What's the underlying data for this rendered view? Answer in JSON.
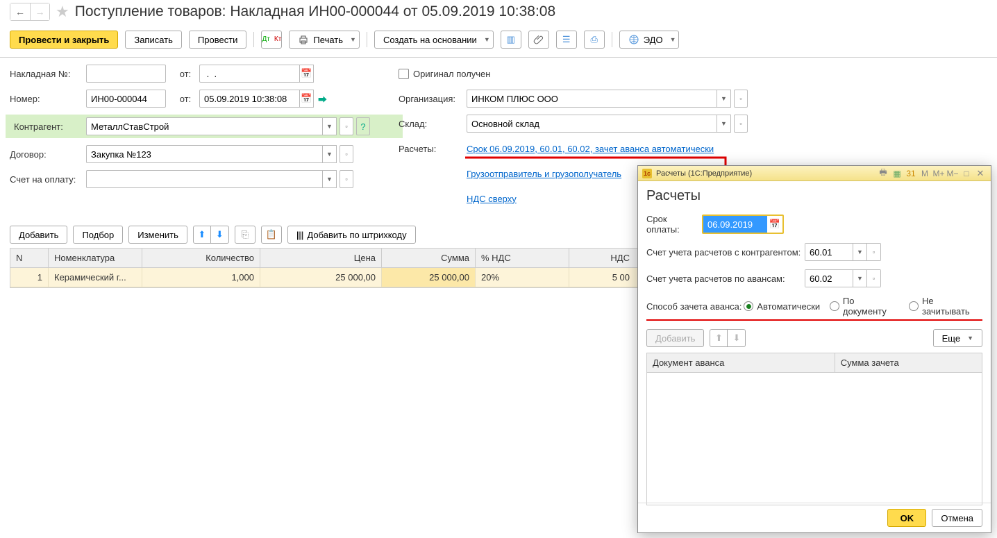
{
  "header": {
    "title": "Поступление товаров: Накладная ИН00-000044 от 05.09.2019 10:38:08"
  },
  "toolbar": {
    "post_close": "Провести и закрыть",
    "save": "Записать",
    "post": "Провести",
    "print": "Печать",
    "create_based": "Создать на основании",
    "edo": "ЭДО"
  },
  "form": {
    "invoice_no_lbl": "Накладная №:",
    "invoice_no": "",
    "from_lbl": "от:",
    "invoice_date": " .  .",
    "number_lbl": "Номер:",
    "number": "ИН00-000044",
    "date": "05.09.2019 10:38:08",
    "counterparty_lbl": "Контрагент:",
    "counterparty": "МеталлСтавСтрой",
    "contract_lbl": "Договор:",
    "contract": "Закупка №123",
    "bill_lbl": "Счет на оплату:",
    "bill": "",
    "original_lbl": "Оригинал получен",
    "org_lbl": "Организация:",
    "org": "ИНКОМ ПЛЮС ООО",
    "warehouse_lbl": "Склад:",
    "warehouse": "Основной склад",
    "calc_lbl": "Расчеты:",
    "calc_link": "Срок 06.09.2019, 60.01, 60.02, зачет аванса автоматически",
    "shipper_link": "Грузоотправитель и грузополучатель",
    "vat_link": "НДС сверху"
  },
  "tbl_toolbar": {
    "add": "Добавить",
    "pick": "Подбор",
    "edit": "Изменить",
    "barcode": "Добавить по штрихкоду"
  },
  "table": {
    "headers": {
      "n": "N",
      "nom": "Номенклатура",
      "qty": "Количество",
      "price": "Цена",
      "sum": "Сумма",
      "vat": "% НДС",
      "vat_sum": "НДС"
    },
    "rows": [
      {
        "n": "1",
        "nom": "Керамический г...",
        "qty": "1,000",
        "price": "25 000,00",
        "sum": "25 000,00",
        "vat": "20%",
        "vat_sum": "5 00"
      }
    ]
  },
  "popup": {
    "titlebar": "Расчеты  (1С:Предприятие)",
    "heading": "Расчеты",
    "due_lbl": "Срок оплаты:",
    "due": "06.09.2019",
    "acct1_lbl": "Счет учета расчетов с контрагентом:",
    "acct1": "60.01",
    "acct2_lbl": "Счет учета расчетов по авансам:",
    "acct2": "60.02",
    "advance_lbl": "Способ зачета аванса:",
    "radio_auto": "Автоматически",
    "radio_doc": "По документу",
    "radio_none": "Не зачитывать",
    "add": "Добавить",
    "more": "Еще",
    "col1": "Документ аванса",
    "col2": "Сумма зачета",
    "ok": "OK",
    "cancel": "Отмена",
    "tb_icons": {
      "m": "M",
      "m_plus": "M+",
      "m_minus": "M−"
    }
  }
}
